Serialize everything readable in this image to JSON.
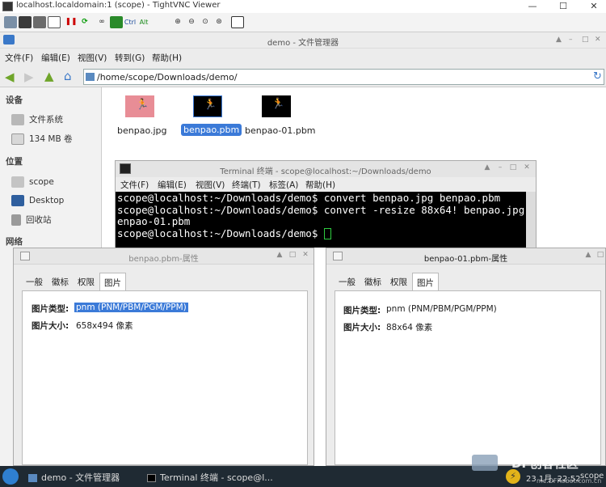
{
  "vnc": {
    "title": "localhost.localdomain:1 (scope) - TightVNC Viewer",
    "toolbar_icons": [
      "new-connection-icon",
      "save-icon",
      "copy-icon",
      "info-icon",
      "pause-icon",
      "refresh-icon",
      "binoculars-icon",
      "floppy-green-icon",
      "ctrl-key",
      "alt-key",
      "zoom-in-icon",
      "zoom-out-icon",
      "zoom-100-icon",
      "zoom-fit-icon",
      "fullscreen-icon"
    ],
    "ctrl_label": "Ctrl",
    "alt_label": "Alt"
  },
  "fm": {
    "title": "demo - 文件管理器",
    "menu": [
      "文件(F)",
      "编辑(E)",
      "视图(V)",
      "转到(G)",
      "帮助(H)"
    ],
    "path": "/home/scope/Downloads/demo/",
    "sidebar": {
      "devices_header": "设备",
      "devices": [
        "文件系统",
        "134 MB 卷"
      ],
      "places_header": "位置",
      "places": [
        "scope",
        "Desktop",
        "回收站"
      ],
      "network_header": "网络"
    },
    "files": [
      "benpao.jpg",
      "benpao.pbm",
      "benpao-01.pbm"
    ]
  },
  "terminal": {
    "title": "Terminal 终端 - scope@localhost:~/Downloads/demo",
    "menu": [
      "文件(F)",
      "编辑(E)",
      "视图(V)",
      "终端(T)",
      "标签(A)",
      "帮助(H)"
    ],
    "lines": [
      "scope@localhost:~/Downloads/demo$ convert benpao.jpg benpao.pbm",
      "scope@localhost:~/Downloads/demo$ convert -resize 88x64! benpao.jpg b",
      "enpao-01.pbm",
      "scope@localhost:~/Downloads/demo$ "
    ]
  },
  "dialog1": {
    "title": "benpao.pbm-属性",
    "tabs": [
      "一般",
      "徽标",
      "权限",
      "图片"
    ],
    "type_label": "图片类型:",
    "type_value": "pnm (PNM/PBM/PGM/PPM)",
    "size_label": "图片大小:",
    "size_value": "658x494 像素"
  },
  "dialog2": {
    "title": "benpao-01.pbm-属性",
    "tabs": [
      "一般",
      "徽标",
      "权限",
      "图片"
    ],
    "type_label": "图片类型:",
    "type_value": "pnm (PNM/PBM/PGM/PPM)",
    "size_label": "图片大小:",
    "size_value": "88x64 像素"
  },
  "taskbar": {
    "items": [
      "demo - 文件管理器",
      "Terminal 终端 - scope@l..."
    ],
    "clock": "23 1月, 22:52",
    "user": "scope",
    "watermark": "DF创客社区",
    "watermark_url": "mc.DFRobot.com.cn"
  },
  "colors": {
    "selection": "#3b7ad8",
    "taskbar": "#1f2a33",
    "terminal_bg": "#000000"
  }
}
